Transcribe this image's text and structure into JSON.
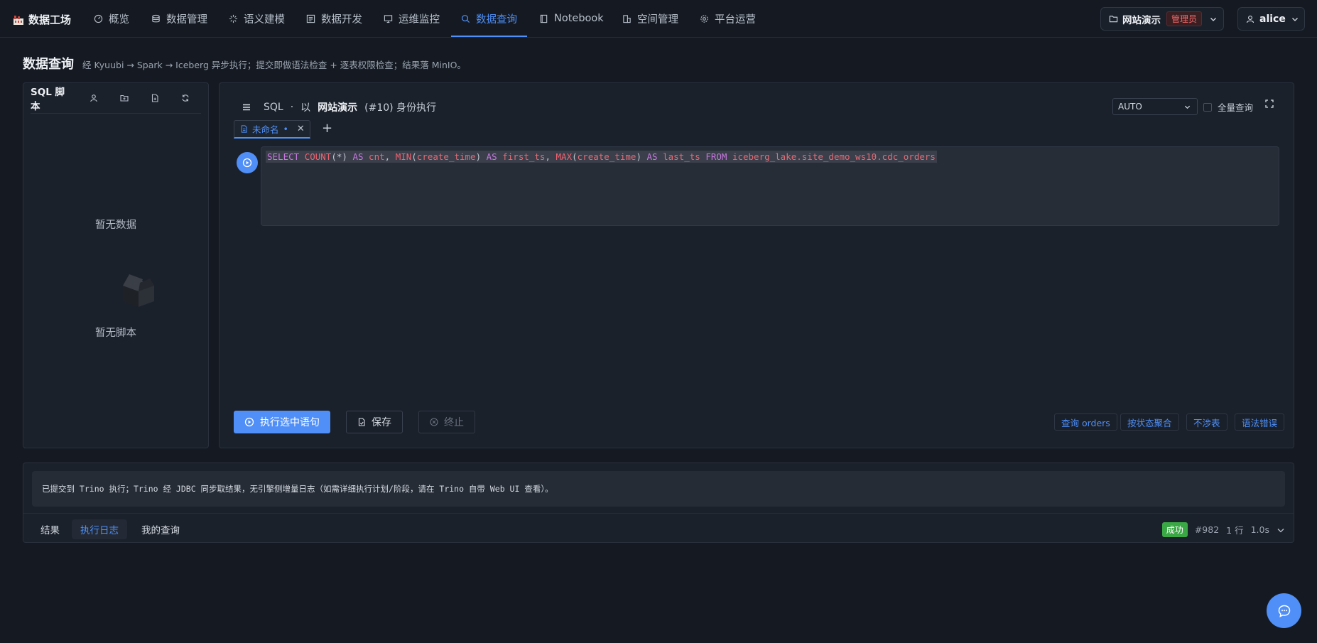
{
  "nav": {
    "brand": "数据工场",
    "items": [
      {
        "label": "概览",
        "icon": "dashboard-icon"
      },
      {
        "label": "数据管理",
        "icon": "database-icon"
      },
      {
        "label": "语义建模",
        "icon": "model-icon"
      },
      {
        "label": "数据开发",
        "icon": "code-icon"
      },
      {
        "label": "运维监控",
        "icon": "monitor-icon"
      },
      {
        "label": "数据查询",
        "icon": "search-icon",
        "active": true
      },
      {
        "label": "Notebook",
        "icon": "notebook-icon"
      },
      {
        "label": "空间管理",
        "icon": "building-icon"
      },
      {
        "label": "平台运营",
        "icon": "gear-icon"
      }
    ],
    "workspace": {
      "name": "网站演示",
      "role": "管理员"
    },
    "user": "alice"
  },
  "page": {
    "title": "数据查询",
    "description": "经 Kyuubi → Spark → Iceberg 异步执行；提交即做语法检查 + 逐表权限检查；结果落 MinIO。"
  },
  "scripts": {
    "title": "SQL 脚本",
    "empty_data": "暂无数据",
    "empty_scripts": "暂无脚本"
  },
  "editor": {
    "mode": "SQL",
    "as_label": "以",
    "workspace": "网站演示",
    "identity": "(#10) 身份执行",
    "engine_value": "AUTO",
    "full_query_label": "全量查询",
    "tab_label": "未命名",
    "sql": "SELECT COUNT(*) AS cnt, MIN(create_time) AS first_ts, MAX(create_time) AS last_ts FROM iceberg_lake.site_demo_ws10.cdc_orders",
    "run_label": "执行选中语句",
    "save_label": "保存",
    "stop_label": "终止",
    "examples": [
      "查询 orders",
      "按状态聚合",
      "不涉表",
      "语法错误"
    ]
  },
  "results": {
    "log_text": "已提交到 Trino 执行；Trino 经 JDBC 同步取结果，无引擎侧增量日志（如需详细执行计划/阶段，请在 Trino 自带 Web UI 查看）。",
    "tabs": [
      "结果",
      "执行日志",
      "我的查询"
    ],
    "active_tab": 1,
    "status": "成功",
    "query_id": "#982",
    "rows": "1 行",
    "duration": "1.0s"
  },
  "colors": {
    "accent": "#4f8ff7",
    "success": "#3aa845",
    "danger": "#f0696b",
    "background": "#151a22"
  }
}
